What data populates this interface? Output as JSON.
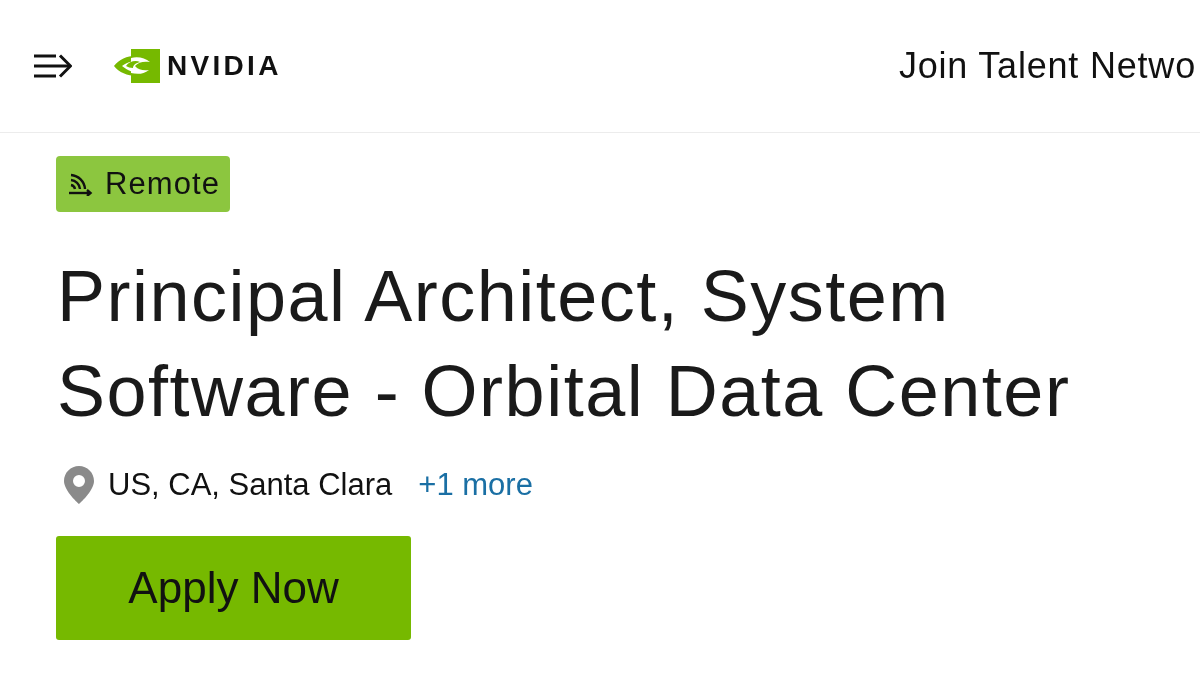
{
  "header": {
    "logo_text": "NVIDIA",
    "link": "Join Talent Netwo"
  },
  "job": {
    "badge": "Remote",
    "title": "Principal Architect, System Software - Orbital Data Center",
    "location": "US, CA, Santa Clara",
    "more_locations": "+1 more",
    "apply_button": "Apply Now"
  }
}
